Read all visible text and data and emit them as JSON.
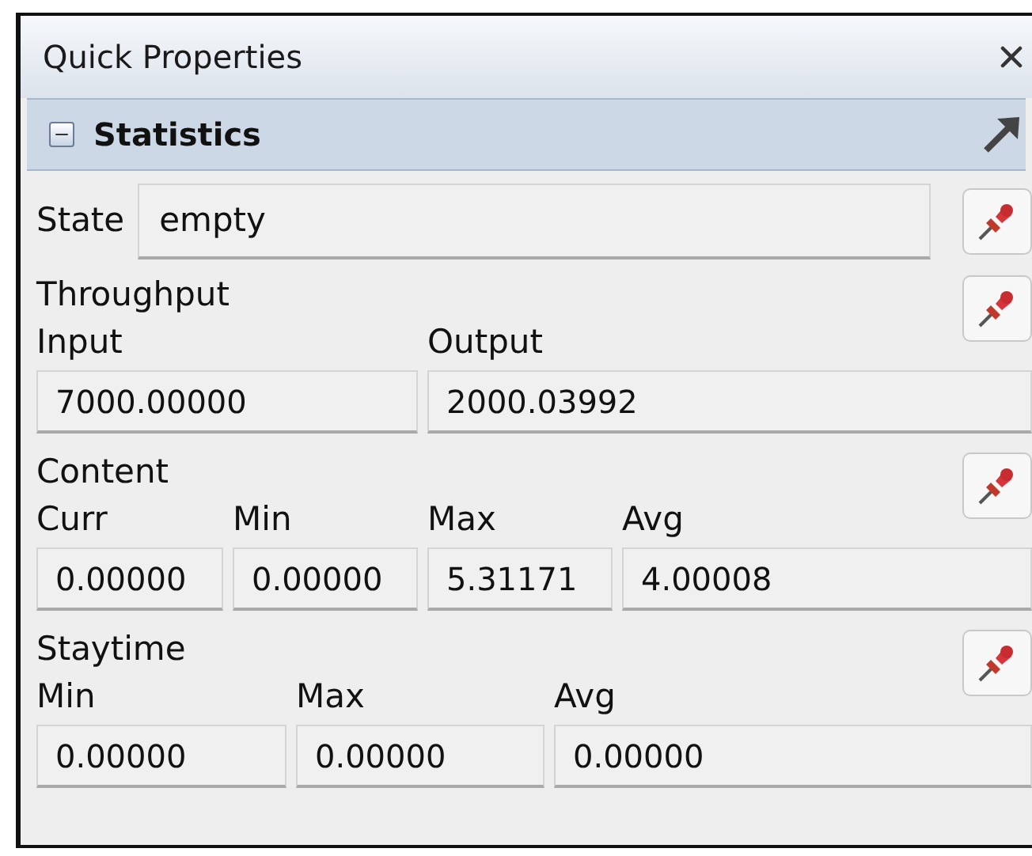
{
  "panel": {
    "title": "Quick Properties"
  },
  "section": {
    "title": "Statistics",
    "expanded": true
  },
  "groups": [
    {
      "kind": "inline",
      "label": "State",
      "value": "empty"
    },
    {
      "kind": "grid",
      "title": "Throughput",
      "fields": [
        {
          "label": "Input",
          "value": "7000.00000"
        },
        {
          "label": "Output",
          "value": "2000.03992"
        }
      ]
    },
    {
      "kind": "grid",
      "title": "Content",
      "fields": [
        {
          "label": "Curr",
          "value": "0.00000"
        },
        {
          "label": "Min",
          "value": "0.00000"
        },
        {
          "label": "Max",
          "value": "5.31171"
        },
        {
          "label": "Avg",
          "value": "4.00008"
        }
      ]
    },
    {
      "kind": "grid",
      "title": "Staytime",
      "fields": [
        {
          "label": "Min",
          "value": "0.00000"
        },
        {
          "label": "Max",
          "value": "0.00000"
        },
        {
          "label": "Avg",
          "value": "0.00000"
        }
      ]
    }
  ]
}
